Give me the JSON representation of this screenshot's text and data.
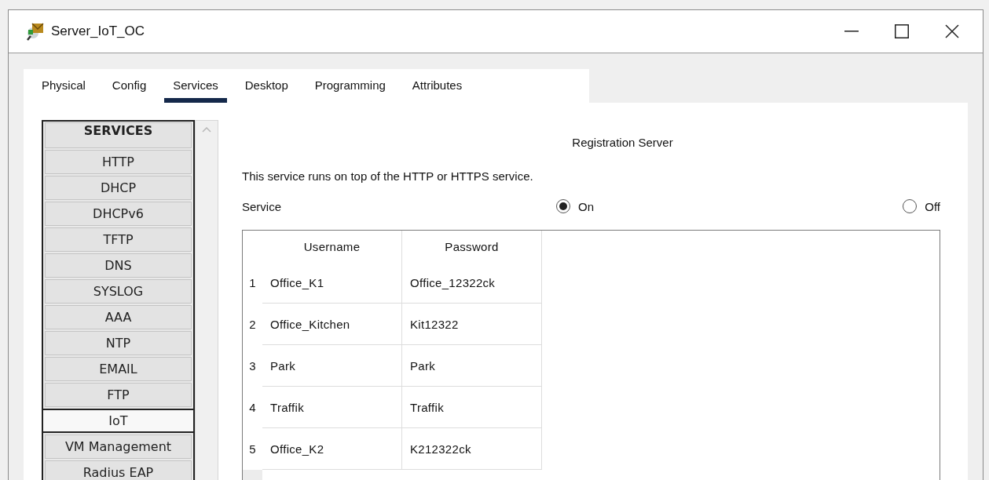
{
  "window": {
    "title": "Server_IoT_OC"
  },
  "tabs": [
    {
      "label": "Physical",
      "selected": false
    },
    {
      "label": "Config",
      "selected": false
    },
    {
      "label": "Services",
      "selected": true
    },
    {
      "label": "Desktop",
      "selected": false
    },
    {
      "label": "Programming",
      "selected": false
    },
    {
      "label": "Attributes",
      "selected": false
    }
  ],
  "services": {
    "heading": "SERVICES",
    "items": [
      {
        "label": "HTTP",
        "selected": false
      },
      {
        "label": "DHCP",
        "selected": false
      },
      {
        "label": "DHCPv6",
        "selected": false
      },
      {
        "label": "TFTP",
        "selected": false
      },
      {
        "label": "DNS",
        "selected": false
      },
      {
        "label": "SYSLOG",
        "selected": false
      },
      {
        "label": "AAA",
        "selected": false
      },
      {
        "label": "NTP",
        "selected": false
      },
      {
        "label": "EMAIL",
        "selected": false
      },
      {
        "label": "FTP",
        "selected": false
      },
      {
        "label": "IoT",
        "selected": true
      },
      {
        "label": "VM Management",
        "selected": false
      },
      {
        "label": "Radius EAP",
        "selected": false
      }
    ]
  },
  "panel": {
    "title": "Registration Server",
    "note": "This service runs on top of the HTTP or HTTPS service.",
    "service": {
      "label": "Service",
      "options": [
        {
          "label": "On",
          "selected": true
        },
        {
          "label": "Off",
          "selected": false
        }
      ]
    },
    "table": {
      "columns": [
        "Username",
        "Password"
      ],
      "rows": [
        {
          "index": "1",
          "cells": [
            "Office_K1",
            "Office_12322ck"
          ]
        },
        {
          "index": "2",
          "cells": [
            "Office_Kitchen",
            "Kit12322"
          ]
        },
        {
          "index": "3",
          "cells": [
            "Park",
            "Park"
          ]
        },
        {
          "index": "4",
          "cells": [
            "Traffik",
            "Traffik"
          ]
        },
        {
          "index": "5",
          "cells": [
            "Office_K2",
            "K212322ck"
          ]
        }
      ]
    }
  }
}
